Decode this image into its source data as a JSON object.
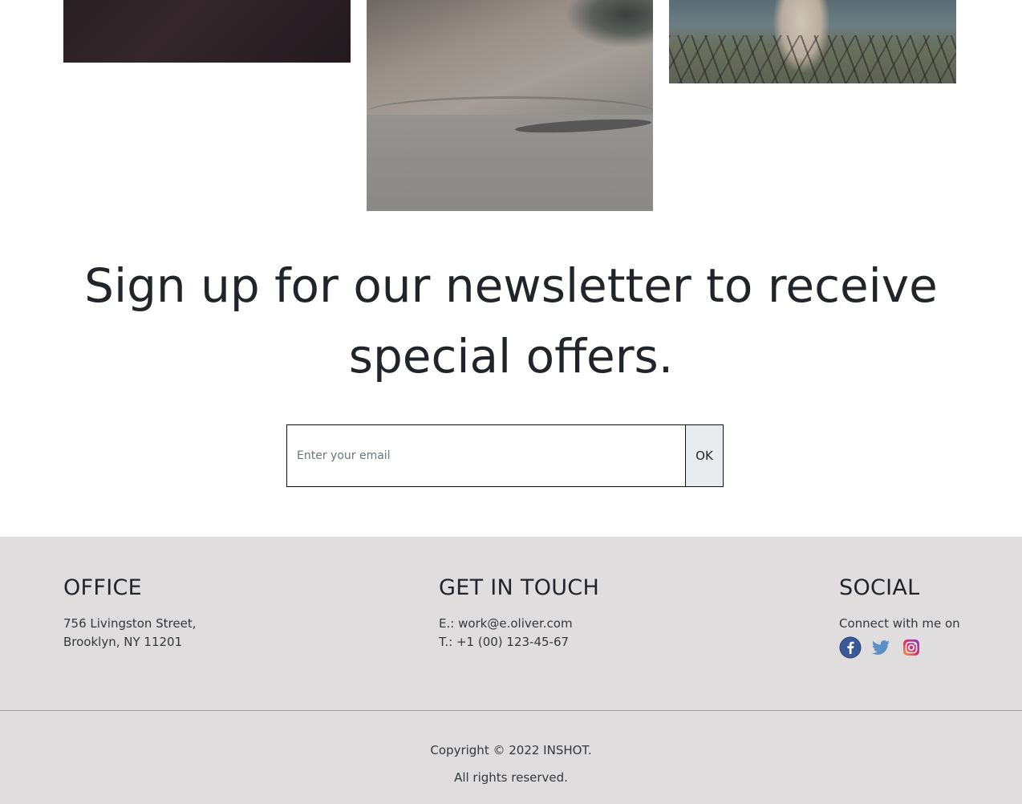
{
  "gallery": {
    "images": [
      "dark-texture-photo",
      "skateboard-ramp-photo",
      "horse-field-photo"
    ]
  },
  "newsletter": {
    "title": "Sign up for our newsletter to receive special offers.",
    "email_placeholder": "Enter your email",
    "submit_label": "OK"
  },
  "footer": {
    "office": {
      "heading": "OFFICE",
      "line1": "756 Livingston Street,",
      "line2": "Brooklyn, NY 11201"
    },
    "contact": {
      "heading": "GET IN TOUCH",
      "email": "E.: work@e.oliver.com",
      "phone": "T.: +1 (00) 123-45-67"
    },
    "social": {
      "heading": "SOCIAL",
      "subtext": "Connect with me on",
      "icons": [
        "facebook-icon",
        "twitter-icon",
        "instagram-icon"
      ]
    },
    "copyright": "Copyright © 2022 INSHOT.",
    "rights": "All rights reserved."
  },
  "colors": {
    "footer_bg": "#dfdddd",
    "text": "#212529",
    "button_bg": "#e9ecef"
  }
}
